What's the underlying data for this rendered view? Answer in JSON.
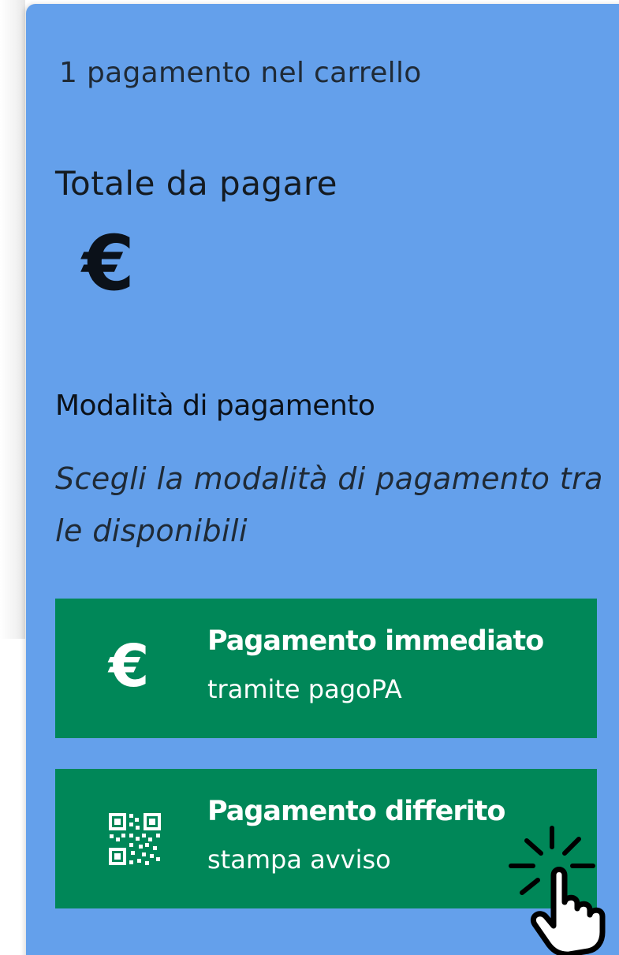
{
  "cart": {
    "count_text": "1 pagamento nel carrello",
    "total_label": "Totale da pagare",
    "total_amount": "€"
  },
  "payment": {
    "heading": "Modalità di pagamento",
    "help_text": "Scegli la modalità di pagamento tra le disponibili",
    "options": [
      {
        "icon": "euro-icon",
        "icon_glyph": "€",
        "title": "Pagamento immediato",
        "subtitle": "tramite pagoPA"
      },
      {
        "icon": "qr-code-icon",
        "title": "Pagamento differito",
        "subtitle": "stampa avviso"
      }
    ]
  },
  "pointer": {
    "icon": "hand-pointer-click-icon"
  },
  "colors": {
    "panel_background": "#64a0eb",
    "option_button": "#008758",
    "text_dark": "#0b1119",
    "text_on_button": "#ffffff"
  }
}
